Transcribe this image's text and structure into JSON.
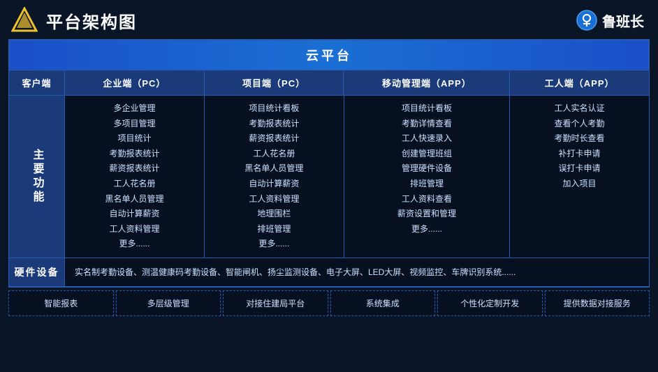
{
  "header": {
    "title": "平台架构图",
    "brand_name": "鲁班长"
  },
  "cloud_platform": {
    "label": "云平台"
  },
  "columns": {
    "client": "客户端",
    "enterprise": "企业端（PC）",
    "project": "项目端（PC）",
    "mobile": "移动管理端（APP）",
    "worker": "工人端（APP）"
  },
  "main_function": {
    "label": "主要功能",
    "enterprise_items": [
      "多企业管理",
      "多项目管理",
      "项目统计",
      "考勤报表统计",
      "薪资报表统计",
      "工人花名册",
      "黑名单人员管理",
      "自动计算薪资",
      "工人资料管理",
      "更多......"
    ],
    "project_items": [
      "项目统计看板",
      "考勤报表统计",
      "薪资报表统计",
      "工人花名册",
      "黑名单人员管理",
      "自动计算薪资",
      "工人资料管理",
      "地理围栏",
      "排班管理",
      "更多......"
    ],
    "mobile_items": [
      "项目统计看板",
      "考勤详情查看",
      "工人快速录入",
      "创建管理班组",
      "管理硬件设备",
      "排班管理",
      "工人资料查看",
      "薪资设置和管理",
      "更多......"
    ],
    "worker_items": [
      "工人实名认证",
      "查看个人考勤",
      "考勤时长查看",
      "补打卡申请",
      "误打卡申请",
      "加入项目"
    ]
  },
  "hardware": {
    "label": "硬件设备",
    "content": "实名制考勤设备、测温健康码考勤设备、智能闸机、扬尘监测设备、电子大屏、LED大屏、视频监控、车牌识别系统......"
  },
  "bottom_features": [
    "智能报表",
    "多层级管理",
    "对接住建局平台",
    "系统集成",
    "个性化定制开发",
    "提供数据对接服务"
  ]
}
